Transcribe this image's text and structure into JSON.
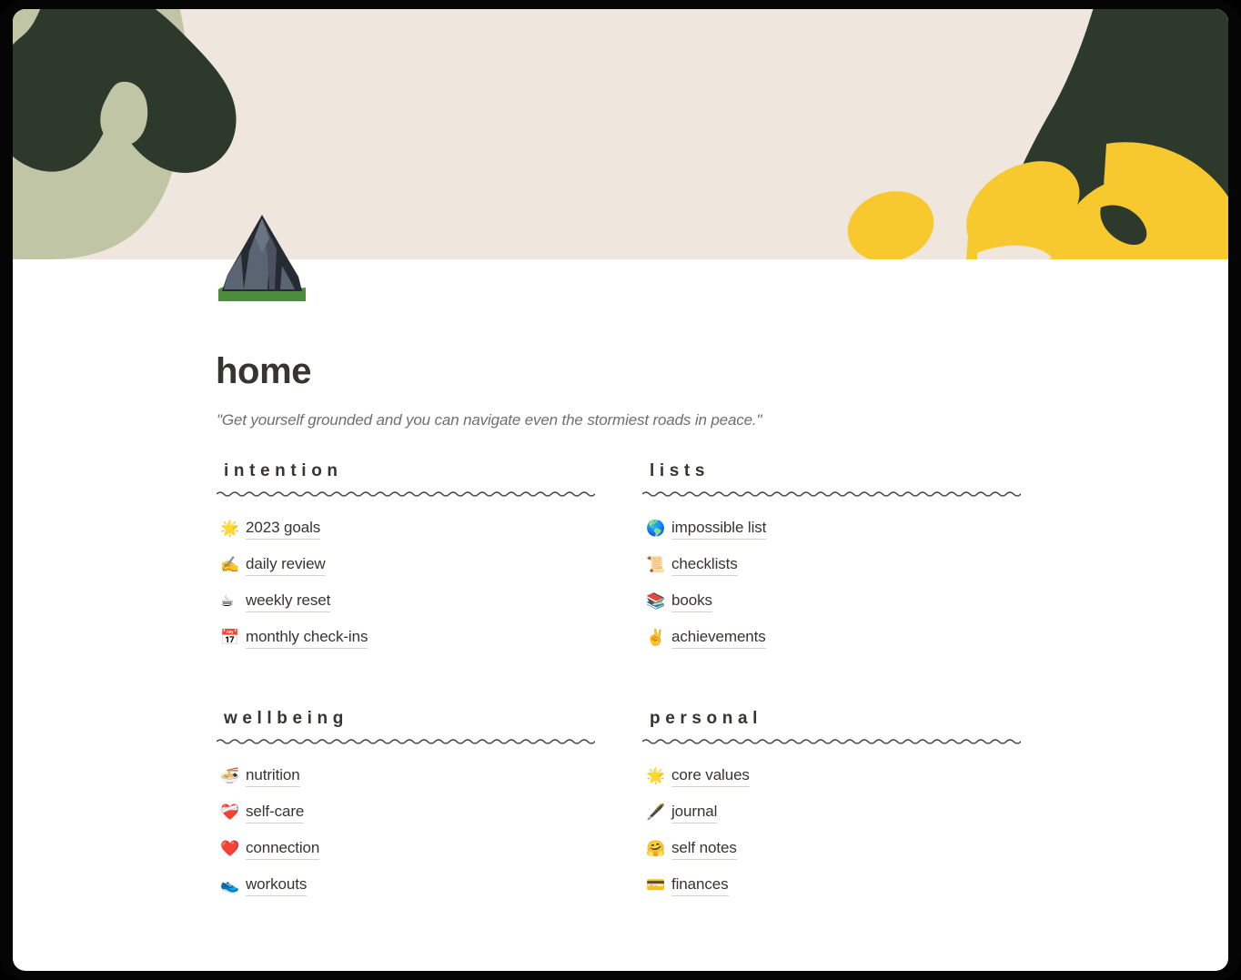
{
  "window": {
    "frame_color": "#050505",
    "page_background": "#ffffff"
  },
  "cover": {
    "name": "abstract-shapes-cover",
    "background_color": "#EFE6DE",
    "palette": {
      "beige": "#EFE6DE",
      "dark_green": "#2D3A2B",
      "sage_green": "#BFC5A5",
      "yellow": "#F7C92E"
    }
  },
  "page_icon": {
    "emoji": "⛰️",
    "icon_name": "mountain-icon"
  },
  "header": {
    "title": "home",
    "quote": "\"Get yourself grounded and you can navigate even the stormiest roads in peace.\""
  },
  "sections": [
    {
      "id": "intention",
      "title": "intention",
      "items": [
        {
          "emoji": "🌟",
          "icon_name": "glowing-star-icon",
          "label": "2023 goals"
        },
        {
          "emoji": "✍️",
          "icon_name": "writing-hand-icon",
          "label": "daily review"
        },
        {
          "emoji": "☕",
          "icon_name": "hot-beverage-icon",
          "label": "weekly reset"
        },
        {
          "emoji": "📅",
          "icon_name": "calendar-icon",
          "label": "monthly check-ins"
        }
      ]
    },
    {
      "id": "lists",
      "title": "lists",
      "items": [
        {
          "emoji": "🌎",
          "icon_name": "globe-americas-icon",
          "label": "impossible list"
        },
        {
          "emoji": "📜",
          "icon_name": "scroll-icon",
          "label": "checklists"
        },
        {
          "emoji": "📚",
          "icon_name": "books-icon",
          "label": "books"
        },
        {
          "emoji": "✌️",
          "icon_name": "victory-hand-icon",
          "label": "achievements"
        }
      ]
    },
    {
      "id": "wellbeing",
      "title": "wellbeing",
      "items": [
        {
          "emoji": "🍜",
          "icon_name": "steaming-bowl-icon",
          "label": "nutrition"
        },
        {
          "emoji": "❤️‍🩹",
          "icon_name": "mending-heart-icon",
          "label": "self-care"
        },
        {
          "emoji": "❤️",
          "icon_name": "red-heart-icon",
          "label": "connection"
        },
        {
          "emoji": "👟",
          "icon_name": "running-shoe-icon",
          "label": "workouts"
        }
      ]
    },
    {
      "id": "personal",
      "title": "personal",
      "items": [
        {
          "emoji": "🌟",
          "icon_name": "glowing-star-icon",
          "label": "core values"
        },
        {
          "emoji": "🖋️",
          "icon_name": "fountain-pen-icon",
          "label": "journal"
        },
        {
          "emoji": "🤗",
          "icon_name": "hugging-face-icon",
          "label": "self notes"
        },
        {
          "emoji": "💳",
          "icon_name": "credit-card-icon",
          "label": "finances"
        }
      ]
    }
  ]
}
